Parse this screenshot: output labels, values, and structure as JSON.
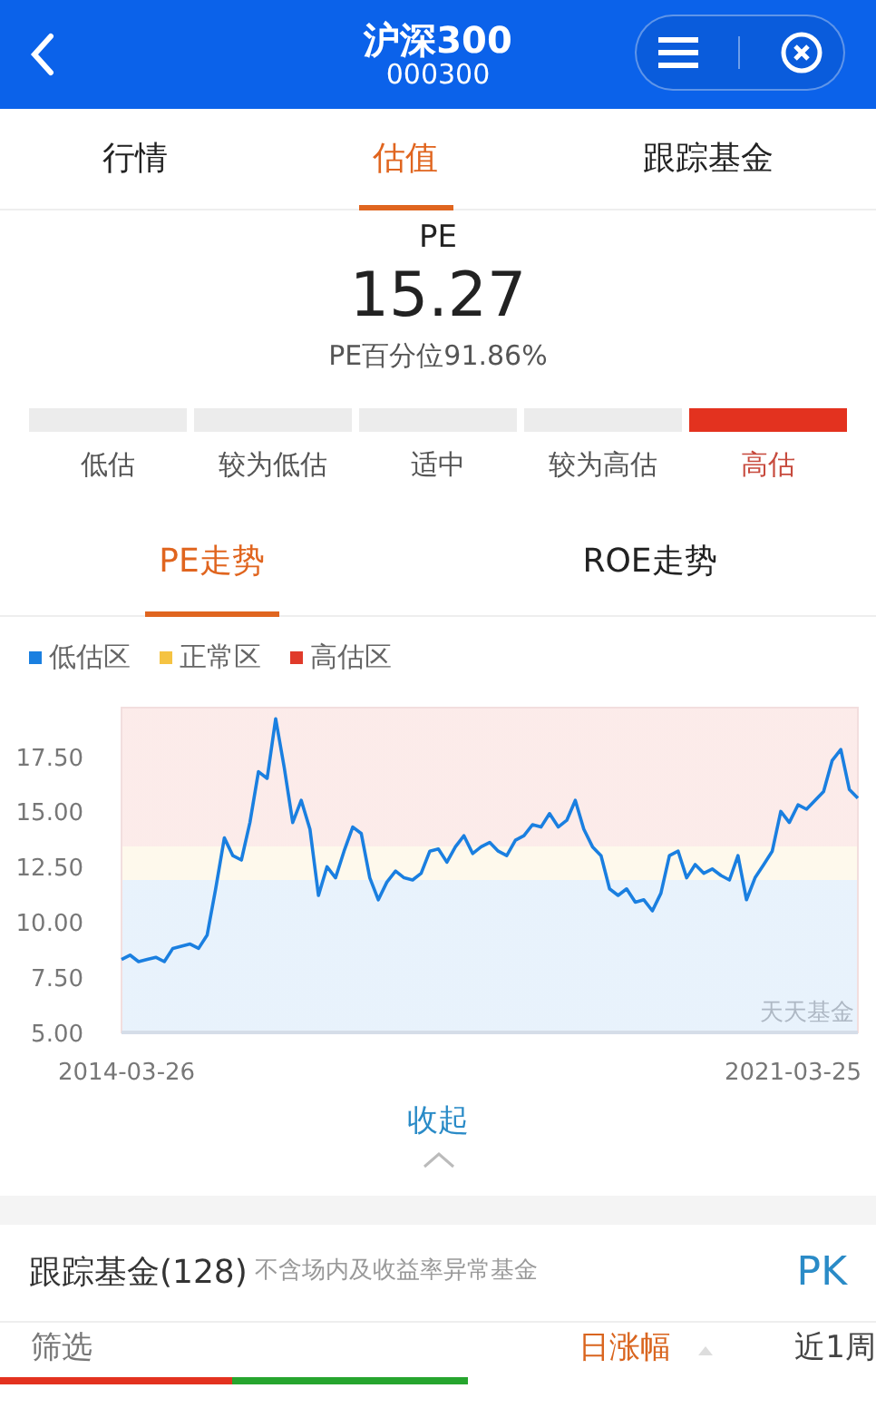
{
  "header": {
    "title": "沪深300",
    "code": "000300"
  },
  "tabs": [
    {
      "label": "行情",
      "selected": false
    },
    {
      "label": "估值",
      "selected": true
    },
    {
      "label": "跟踪基金",
      "selected": false
    }
  ],
  "valuation": {
    "metric": "PE",
    "value": "15.27",
    "percentile": "PE百分位91.86%",
    "levels": [
      {
        "label": "低估",
        "selected": false
      },
      {
        "label": "较为低估",
        "selected": false
      },
      {
        "label": "适中",
        "selected": false
      },
      {
        "label": "较为高估",
        "selected": false
      },
      {
        "label": "高估",
        "selected": true
      }
    ]
  },
  "chart_tabs": [
    {
      "label": "PE走势",
      "selected": true
    },
    {
      "label": "ROE走势",
      "selected": false
    }
  ],
  "legend": [
    {
      "label": "低估区",
      "color": "#1a7fe0"
    },
    {
      "label": "正常区",
      "color": "#f5c342"
    },
    {
      "label": "高估区",
      "color": "#e03a2a"
    }
  ],
  "chart": {
    "watermark": "天天基金",
    "start_date": "2014-03-26",
    "end_date": "2021-03-25",
    "chart_data": {
      "type": "line",
      "ylim": [
        5,
        19.7
      ],
      "yticks": [
        {
          "value": 5,
          "label": "5.00"
        },
        {
          "value": 7.5,
          "label": "7.50"
        },
        {
          "value": 10,
          "label": "10.00"
        },
        {
          "value": 12.5,
          "label": "12.50"
        },
        {
          "value": 15,
          "label": "15.00"
        },
        {
          "value": 17.5,
          "label": "17.50"
        }
      ],
      "series": [
        {
          "color": "#1a7fe0",
          "values": [
            8.3,
            8.5,
            8.2,
            8.3,
            8.4,
            8.2,
            8.8,
            8.9,
            9.0,
            8.8,
            9.4,
            11.5,
            13.8,
            13.0,
            12.8,
            14.5,
            16.8,
            16.5,
            19.2,
            17.0,
            14.5,
            15.5,
            14.2,
            11.2,
            12.5,
            12.0,
            13.2,
            14.3,
            14.0,
            12.0,
            11.0,
            11.8,
            12.3,
            12.0,
            11.9,
            12.2,
            13.2,
            13.3,
            12.7,
            13.4,
            13.9,
            13.1,
            13.4,
            13.6,
            13.2,
            13.0,
            13.7,
            13.9,
            14.4,
            14.3,
            14.9,
            14.3,
            14.6,
            15.5,
            14.2,
            13.4,
            13.0,
            11.5,
            11.2,
            11.5,
            10.9,
            11.0,
            10.5,
            11.3,
            13.0,
            13.2,
            12.0,
            12.6,
            12.2,
            12.4,
            12.1,
            11.9,
            13.0,
            11.0,
            12.0,
            12.6,
            13.2,
            15.0,
            14.5,
            15.3,
            15.1,
            15.5,
            15.9,
            17.3,
            17.8,
            16.0,
            15.6
          ]
        }
      ]
    }
  },
  "collapse": {
    "label": "收起",
    "expanded": true
  },
  "funds": {
    "title": "跟踪基金(128)",
    "note": "不含场内及收益率异常基金",
    "action": "PK",
    "columns": [
      {
        "label": "筛选",
        "selected": false
      },
      {
        "label": "日涨幅",
        "selected": true
      },
      {
        "label": "近1周",
        "selected": false
      }
    ]
  }
}
